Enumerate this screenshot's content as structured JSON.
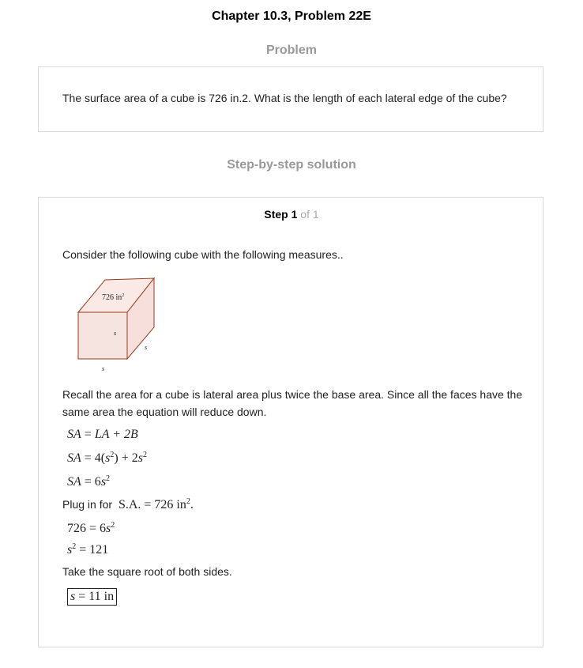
{
  "header": {
    "title": "Chapter 10.3, Problem 22E"
  },
  "problem": {
    "heading": "Problem",
    "text": "The surface area of a cube is 726 in.2. What is the length of each lateral edge of the cube?"
  },
  "solution": {
    "heading": "Step-by-step solution",
    "step": {
      "word": "Step",
      "number": "1",
      "of_text": "of 1"
    },
    "intro": "Consider the following cube with the following measures..",
    "figure": {
      "area_label": "726 in",
      "area_exp": "2",
      "edge_label": "s"
    },
    "recall": "Recall the area for a cube is lateral area plus twice the base area. Since all the faces have the same area the equation will reduce down.",
    "eq1": {
      "lhs": "SA",
      "eq": " = ",
      "rhs": "LA + 2B"
    },
    "eq2": {
      "lhs": "SA",
      "a": " = 4(",
      "s1": "s",
      "exp1": "2",
      "b": ") + 2",
      "s2": "s",
      "exp2": "2"
    },
    "eq3": {
      "lhs": "SA",
      "a": " = 6",
      "s": "s",
      "exp": "2"
    },
    "plug_text": "Plug in for",
    "plug_math": "S.A. = 726 in",
    "plug_exp": "2",
    "plug_end": ".",
    "eq4": {
      "a": "726 = 6",
      "s": "s",
      "exp": "2"
    },
    "eq5": {
      "s": "s",
      "exp": "2",
      "rest": " = 121"
    },
    "sqrt_text": "Take the square root of both sides.",
    "answer": {
      "s": "s",
      "rest": " = 11 in"
    }
  }
}
